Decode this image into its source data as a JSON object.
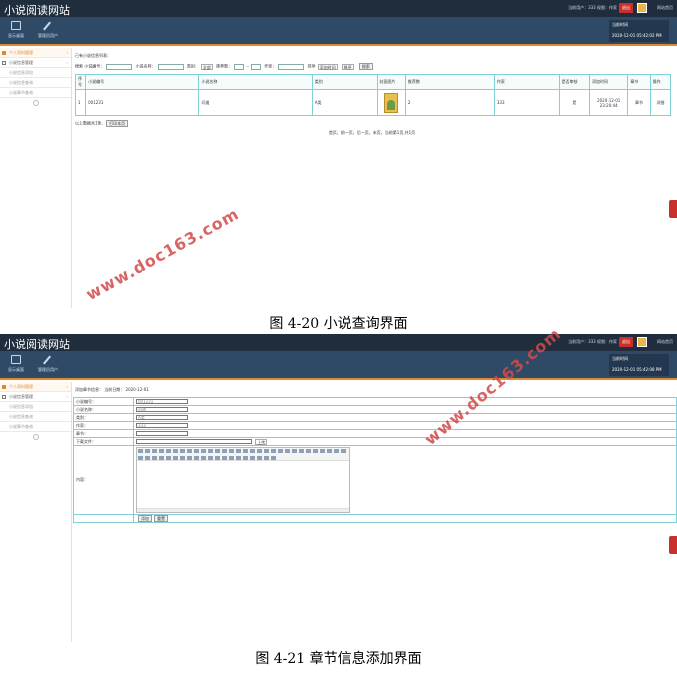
{
  "header": {
    "site_title": "小说阅读网站",
    "user_info": "当前用户：333 权限：作家",
    "logout": "退出",
    "site_link": "网站首页"
  },
  "nav": {
    "items": [
      {
        "label": "显示桌面",
        "icon": "monitor-icon"
      },
      {
        "label": "管理员用户",
        "icon": "pen-icon"
      }
    ]
  },
  "shot1": {
    "time_label": "当前时间",
    "time_value": "2020-12-01 05:42:02 PM",
    "sidebar": {
      "personal": "个人资料管理",
      "group": "小说信息管理",
      "items": [
        "小说信息添加",
        "小说信息查询",
        "小说章节查询"
      ]
    },
    "title": "已有小说信息列表：",
    "search": {
      "label": "搜索",
      "fields": [
        "小说编号：",
        "小说名称：",
        "类别：",
        "",
        "推荐数：",
        "--",
        "作家：",
        "排序"
      ],
      "category_value": "全部",
      "sort_field": "添加时间",
      "sort_order": "降序",
      "button": "搜索"
    },
    "table": {
      "headers": [
        "序号",
        "小说编号",
        "小说名称",
        "类别",
        "封面图片",
        "推荐数",
        "作家",
        "是否审核",
        "添加时间",
        "章节",
        "操作"
      ],
      "rows": [
        {
          "seq": "1",
          "id": "001231",
          "name": "问道",
          "cat": "A类",
          "rec": "2",
          "author": "333",
          "audit": "是",
          "time": "2020-12-01 23:20:44",
          "chapter": "章节",
          "op": "详细"
        }
      ]
    },
    "total": "以上数据共1条,",
    "print": "打印本页",
    "pager": "首页，前一页，后一页，末页，当前第1页,共1页"
  },
  "caption1": "图 4-20  小说查询界面",
  "shot2": {
    "time_label": "当前时间",
    "time_value": "2020-12-01 05:42:08 PM",
    "form_title": "添加章节信息：  当前日期：  2020-12-01",
    "rows": [
      {
        "label": "小说编号：",
        "value": "001231"
      },
      {
        "label": "小说名称：",
        "value": "问道"
      },
      {
        "label": "类别：",
        "value": "A类"
      },
      {
        "label": "作家：",
        "value": "333"
      },
      {
        "label": "章节：",
        "value": ""
      }
    ],
    "upload_label": "下载文件：",
    "upload_btn": "上传",
    "content_label": "内容：",
    "submit": "添加",
    "reset": "重置"
  },
  "caption2": "图 4-21 章节信息添加界面",
  "watermark": "www.doc163.com",
  "colors": {
    "topbar": "#1f2d3d",
    "navband": "#2f4a66",
    "accent": "#e08a2f",
    "grid": "#7fd0d8",
    "watermark": "#d24a4a"
  }
}
